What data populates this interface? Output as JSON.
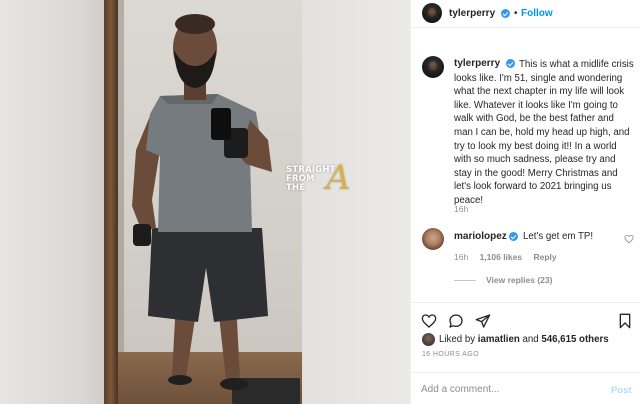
{
  "header": {
    "username": "tylerperry",
    "separator": "•",
    "follow_label": "Follow"
  },
  "watermark": {
    "lines": [
      "STRAIGHT",
      "FROM",
      "THE"
    ],
    "letter": "A"
  },
  "caption": {
    "username": "tylerperry",
    "text": "This is what a midlife crisis looks like. I'm 51, single and wondering what the next chapter in my life will look like. Whatever it looks like I'm going to walk with God, be the best father and man I can be, hold my head up high, and try to look my best doing it!! In a world with so much sadness, please try and stay in the good! Merry Christmas and let's look forward to 2021 bringing us peace!",
    "time": "16h"
  },
  "comment": {
    "username": "mariolopez",
    "text": "Let's get em TP!",
    "time": "16h",
    "likes": "1,106 likes",
    "reply_label": "Reply",
    "view_replies": "View replies (23)"
  },
  "likes": {
    "prefix": "Liked by ",
    "liker": "iamatlien",
    "middle": " and ",
    "others": "546,615 others"
  },
  "time_ago": "16 HOURS AGO",
  "add_comment": {
    "placeholder": "Add a comment...",
    "post_label": "Post"
  },
  "colors": {
    "link_blue": "#0095f6",
    "verified_blue": "#3897f0",
    "muted_gray": "#8e8e8e",
    "post_disabled": "#b3dbff"
  },
  "icons": {
    "header_verified": "verified-badge-icon",
    "like": "heart-icon",
    "comment": "comment-bubble-icon",
    "share": "paper-plane-icon",
    "save": "bookmark-icon"
  }
}
